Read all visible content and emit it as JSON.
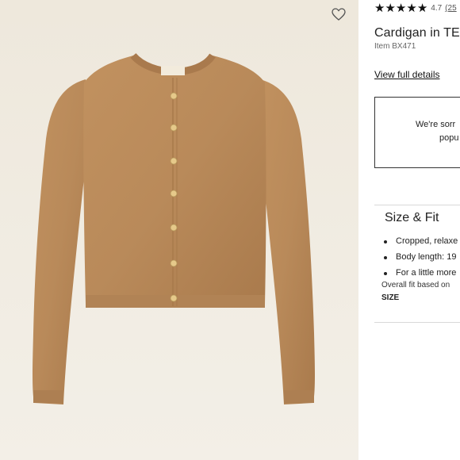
{
  "product": {
    "rating_value": "4.7",
    "rating_count": "(25",
    "stars_filled": 5,
    "title": "Cardigan in TE",
    "item_code": "Item BX471",
    "view_details": "View full details"
  },
  "notice": {
    "line1": "We're sorr",
    "line2": "popu"
  },
  "size_fit": {
    "title": "Size & Fit",
    "bullets": [
      "Cropped, relaxe",
      "Body length: 19",
      "For a little more"
    ],
    "overall_fit": "Overall fit based on",
    "size_label": "SIZE"
  },
  "icons": {
    "favorite": "heart-outline-icon",
    "star": "star-icon"
  },
  "colors": {
    "image_background": "#efe9de",
    "cardigan": "#b98a5d",
    "buttons": "#e6c98a",
    "text": "#222222"
  }
}
